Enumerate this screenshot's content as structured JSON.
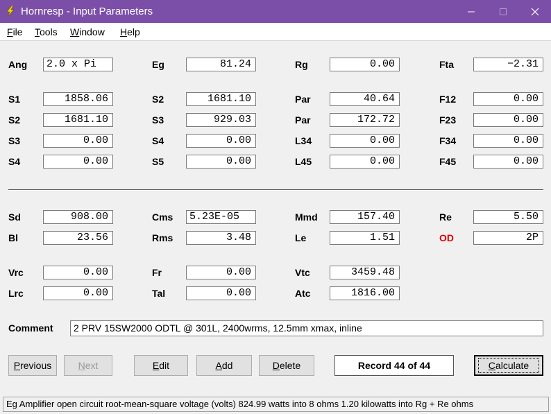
{
  "window": {
    "title": "Hornresp - Input Parameters"
  },
  "menu": [
    {
      "mnemonic": "F",
      "rest": "ile"
    },
    {
      "mnemonic": "T",
      "rest": "ools"
    },
    {
      "mnemonic": "W",
      "rest": "indow"
    },
    {
      "mnemonic": "H",
      "rest": "elp"
    }
  ],
  "params": {
    "ang": {
      "label": "Ang",
      "value": "2.0 x Pi"
    },
    "eg": {
      "label": "Eg",
      "value": "81.24"
    },
    "rg": {
      "label": "Rg",
      "value": "0.00"
    },
    "fta": {
      "label": "Fta",
      "value": "−2.31"
    },
    "s1": {
      "label": "S1",
      "value": "1858.06"
    },
    "s2a": {
      "label": "S2",
      "value": "1681.10"
    },
    "par1": {
      "label": "Par",
      "value": "40.64"
    },
    "f12": {
      "label": "F12",
      "value": "0.00"
    },
    "s2b": {
      "label": "S2",
      "value": "1681.10"
    },
    "s3a": {
      "label": "S3",
      "value": "929.03"
    },
    "par2": {
      "label": "Par",
      "value": "172.72"
    },
    "f23": {
      "label": "F23",
      "value": "0.00"
    },
    "s3b": {
      "label": "S3",
      "value": "0.00"
    },
    "s4a": {
      "label": "S4",
      "value": "0.00"
    },
    "l34": {
      "label": "L34",
      "value": "0.00"
    },
    "f34": {
      "label": "F34",
      "value": "0.00"
    },
    "s4b": {
      "label": "S4",
      "value": "0.00"
    },
    "s5": {
      "label": "S5",
      "value": "0.00"
    },
    "l45": {
      "label": "L45",
      "value": "0.00"
    },
    "f45": {
      "label": "F45",
      "value": "0.00"
    },
    "sd": {
      "label": "Sd",
      "value": "908.00"
    },
    "cms": {
      "label": "Cms",
      "value": "5.23E-05"
    },
    "mmd": {
      "label": "Mmd",
      "value": "157.40"
    },
    "re": {
      "label": "Re",
      "value": "5.50"
    },
    "bl": {
      "label": "Bl",
      "value": "23.56"
    },
    "rms": {
      "label": "Rms",
      "value": "3.48"
    },
    "le": {
      "label": "Le",
      "value": "1.51"
    },
    "od": {
      "label": "OD",
      "value": "2P",
      "label_color": "#e00000"
    },
    "vrc": {
      "label": "Vrc",
      "value": "0.00"
    },
    "fr": {
      "label": "Fr",
      "value": "0.00"
    },
    "vtc": {
      "label": "Vtc",
      "value": "3459.48"
    },
    "lrc": {
      "label": "Lrc",
      "value": "0.00"
    },
    "tal": {
      "label": "Tal",
      "value": "0.00"
    },
    "atc": {
      "label": "Atc",
      "value": "1816.00"
    }
  },
  "comment": {
    "label": "Comment",
    "value": "2 PRV 15SW2000 ODTL @ 301L, 2400wrms, 12.5mm xmax, inline"
  },
  "buttons": {
    "previous": {
      "mnemonic": "P",
      "rest": "revious"
    },
    "next": {
      "mnemonic": "N",
      "rest": "ext"
    },
    "edit": {
      "mnemonic": "E",
      "rest": "dit"
    },
    "add": {
      "mnemonic": "A",
      "rest": "dd"
    },
    "delete": {
      "mnemonic": "D",
      "rest": "elete"
    },
    "calculate": {
      "mnemonic": "C",
      "rest": "alculate"
    }
  },
  "record": {
    "text": "Record 44 of 44"
  },
  "status": {
    "text": "Eg   Amplifier open circuit root-mean-square voltage  (volts)   824.99 watts into 8 ohms   1.20 kilowatts into Rg + Re ohms"
  },
  "colors": {
    "titlebar": "#7b4fa8",
    "accent_red": "#e00000"
  }
}
